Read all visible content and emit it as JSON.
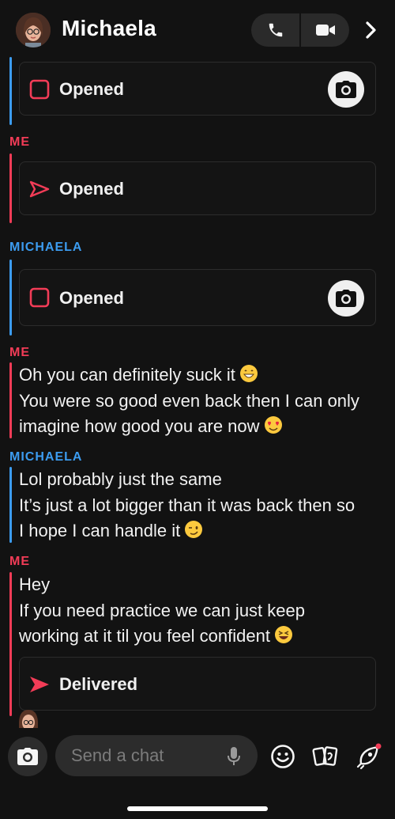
{
  "header": {
    "contact_name": "Michaela",
    "icons": [
      "avatar-bitmoji",
      "phone-icon",
      "video-icon",
      "chevron-right-icon"
    ]
  },
  "thread": {
    "items": [
      {
        "type": "snap",
        "sender": "MICHAELA",
        "status": "Opened",
        "icon": "square-snap-icon",
        "replay": true
      },
      {
        "type": "sender",
        "name": "ME"
      },
      {
        "type": "snap",
        "sender": "ME",
        "status": "Opened",
        "icon": "arrow-outline-icon"
      },
      {
        "type": "sender",
        "name": "MICHAELA"
      },
      {
        "type": "snap",
        "sender": "MICHAELA",
        "status": "Opened",
        "icon": "square-snap-icon",
        "replay": true
      },
      {
        "type": "sender",
        "name": "ME"
      },
      {
        "type": "text",
        "lines": [
          "Oh you can definitely suck it",
          "You were so good even back then I can only",
          "imagine how good you are now"
        ]
      },
      {
        "type": "sender",
        "name": "MICHAELA"
      },
      {
        "type": "text",
        "lines": [
          "Lol probably just the same",
          "It’s just a lot bigger than it was back then so",
          "I hope I can handle it"
        ]
      },
      {
        "type": "sender",
        "name": "ME"
      },
      {
        "type": "text",
        "lines": [
          "Hey",
          "If you need practice we can just keep",
          "working at it til you feel confident"
        ]
      },
      {
        "type": "snap",
        "sender": "ME",
        "status": "Delivered",
        "icon": "arrow-filled-icon"
      }
    ]
  },
  "labels": {
    "me": "ME",
    "michaela": "MICHAELA",
    "opened": "Opened",
    "delivered": "Delivered"
  },
  "composer": {
    "placeholder": "Send a chat",
    "icons": [
      "camera-icon",
      "mic-icon",
      "smiley-icon",
      "stickers-icon",
      "rocket-icon"
    ]
  },
  "colors": {
    "me": "#f23c57",
    "michaela": "#3c9cf0",
    "background": "#121212",
    "emoji": "#fcc93e"
  }
}
